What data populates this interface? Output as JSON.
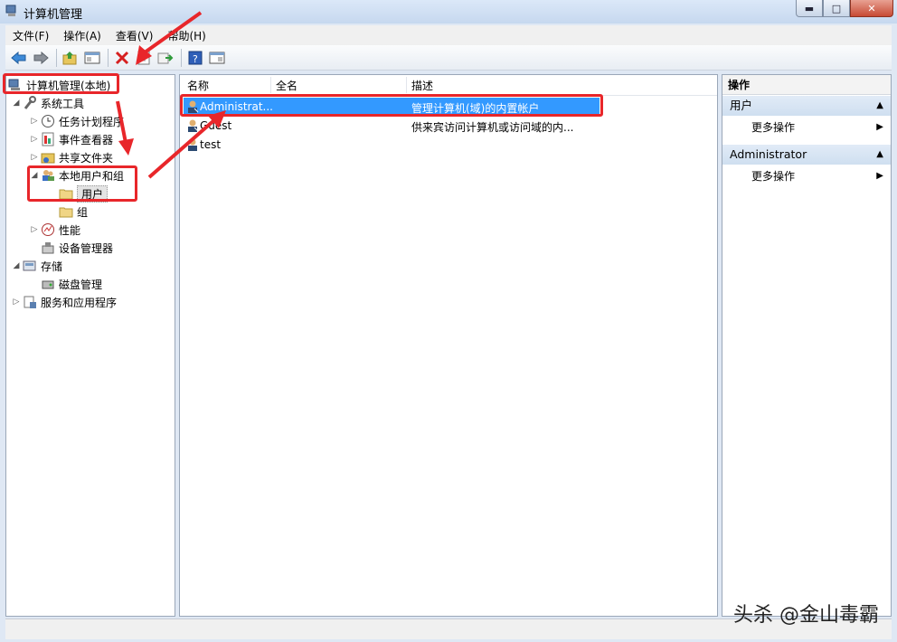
{
  "window": {
    "title": "计算机管理",
    "min_glyph": "▬",
    "max_glyph": "□",
    "close_glyph": "✕"
  },
  "menu": [
    "文件(F)",
    "操作(A)",
    "查看(V)",
    "帮助(H)"
  ],
  "toolbar": {
    "icons": [
      "back-icon",
      "forward-icon",
      "up-folder-icon",
      "show-hide-tree-icon",
      "delete-icon",
      "properties-icon",
      "export-icon",
      "help-icon",
      "view-icon"
    ]
  },
  "tree": {
    "root": "计算机管理(本地)",
    "system_tools": "系统工具",
    "task_scheduler": "任务计划程序",
    "event_viewer": "事件查看器",
    "shared_folders": "共享文件夹",
    "local_users_groups": "本地用户和组",
    "users": "用户",
    "groups": "组",
    "performance": "性能",
    "device_manager": "设备管理器",
    "storage": "存储",
    "disk_management": "磁盘管理",
    "services_apps": "服务和应用程序"
  },
  "list": {
    "columns": [
      "名称",
      "全名",
      "描述"
    ],
    "rows": [
      {
        "name": "Administrat...",
        "fullname": "",
        "description": "管理计算机(域)的内置帐户",
        "selected": true
      },
      {
        "name": "Guest",
        "fullname": "",
        "description": "供来宾访问计算机或访问域的内...",
        "selected": false
      },
      {
        "name": "test",
        "fullname": "",
        "description": "",
        "selected": false
      }
    ]
  },
  "actions": {
    "title": "操作",
    "group1": "用户",
    "group1_item": "更多操作",
    "group2": "Administrator",
    "group2_item": "更多操作",
    "collapse_glyph": "▲",
    "arrow_glyph": "▶"
  },
  "watermark": "头杀 @金山毒霸",
  "colors": {
    "selection": "#3399ff",
    "annotation": "#e8262a"
  }
}
